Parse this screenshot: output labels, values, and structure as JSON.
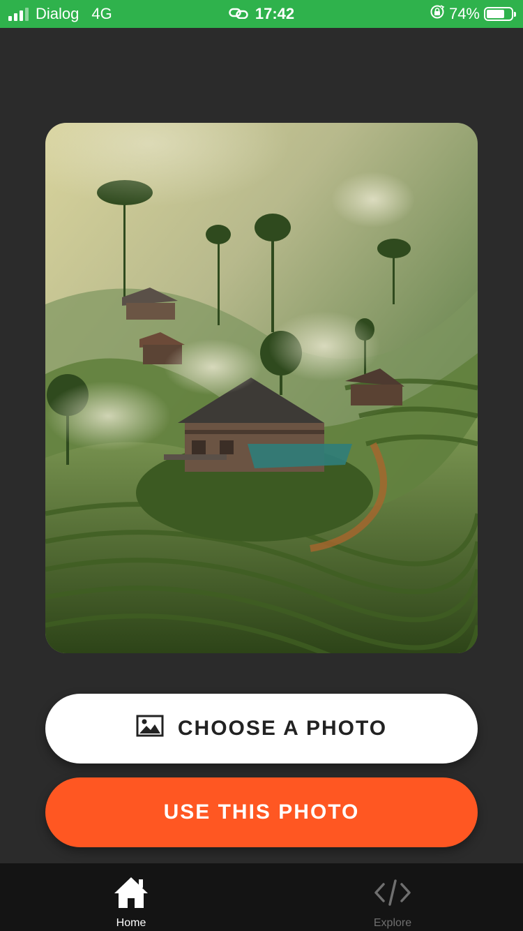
{
  "status_bar": {
    "carrier": "Dialog",
    "network": "4G",
    "time": "17:42",
    "battery_percent": "74%",
    "battery_level": 0.74,
    "icons": [
      "signal-icon",
      "link-icon",
      "rotation-lock-icon",
      "battery-icon"
    ],
    "color": "#2fb24c"
  },
  "photo": {
    "icon": "photo-preview"
  },
  "buttons": {
    "choose_label": "CHOOSE A PHOTO",
    "choose_icon": "image-icon",
    "use_label": "USE THIS PHOTO",
    "use_color": "#ff5722"
  },
  "bottom_nav": {
    "items": [
      {
        "label": "Home",
        "icon": "home-icon",
        "active": true
      },
      {
        "label": "Explore",
        "icon": "code-icon",
        "active": false
      }
    ]
  }
}
